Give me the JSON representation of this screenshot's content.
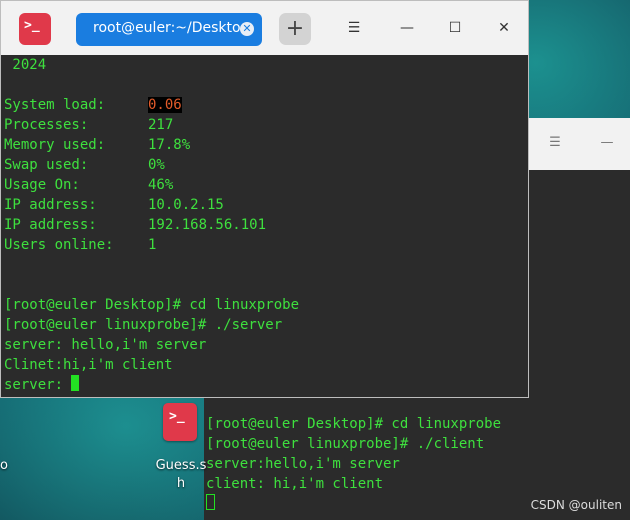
{
  "terminal_main": {
    "tab_title": "root@euler:~/Deskto…",
    "year_line": " 2024",
    "stats": [
      {
        "label": "System load:",
        "value": "0.06",
        "highlight": true
      },
      {
        "label": "Processes:",
        "value": "217"
      },
      {
        "label": "Memory used:",
        "value": "17.8%"
      },
      {
        "label": "Swap used:",
        "value": "0%"
      },
      {
        "label": "Usage On:",
        "value": "46%"
      },
      {
        "label": "IP address:",
        "value": "10.0.2.15"
      },
      {
        "label": "IP address:",
        "value": "192.168.56.101"
      },
      {
        "label": "Users online:",
        "value": "1"
      }
    ],
    "session": [
      "[root@euler Desktop]# cd linuxprobe",
      "[root@euler linuxprobe]# ./server",
      "server: hello,i'm server",
      "Clinet:hi,i'm client",
      "server: "
    ],
    "icons": {
      "app": "terminal-icon",
      "tab_close": "close-icon",
      "new_tab": "plus-icon",
      "menu": "menu-icon",
      "minimize": "minimize-icon",
      "maximize": "maximize-icon",
      "close": "close-icon"
    }
  },
  "terminal_client": {
    "session": [
      "[root@euler Desktop]# cd linuxprobe",
      "[root@euler linuxprobe]# ./client",
      "server:hello,i'm server",
      "client: hi,i'm client"
    ]
  },
  "desktop": {
    "icon_label_line1": "Guess.s",
    "icon_label_line2": "h",
    "left_label": "o"
  },
  "watermark": "CSDN @ouliten",
  "colors": {
    "terminal_green": "#3ee03e",
    "tab_blue": "#1a7de0",
    "app_red": "#e0394a",
    "highlight_orange": "#e35b2a"
  }
}
